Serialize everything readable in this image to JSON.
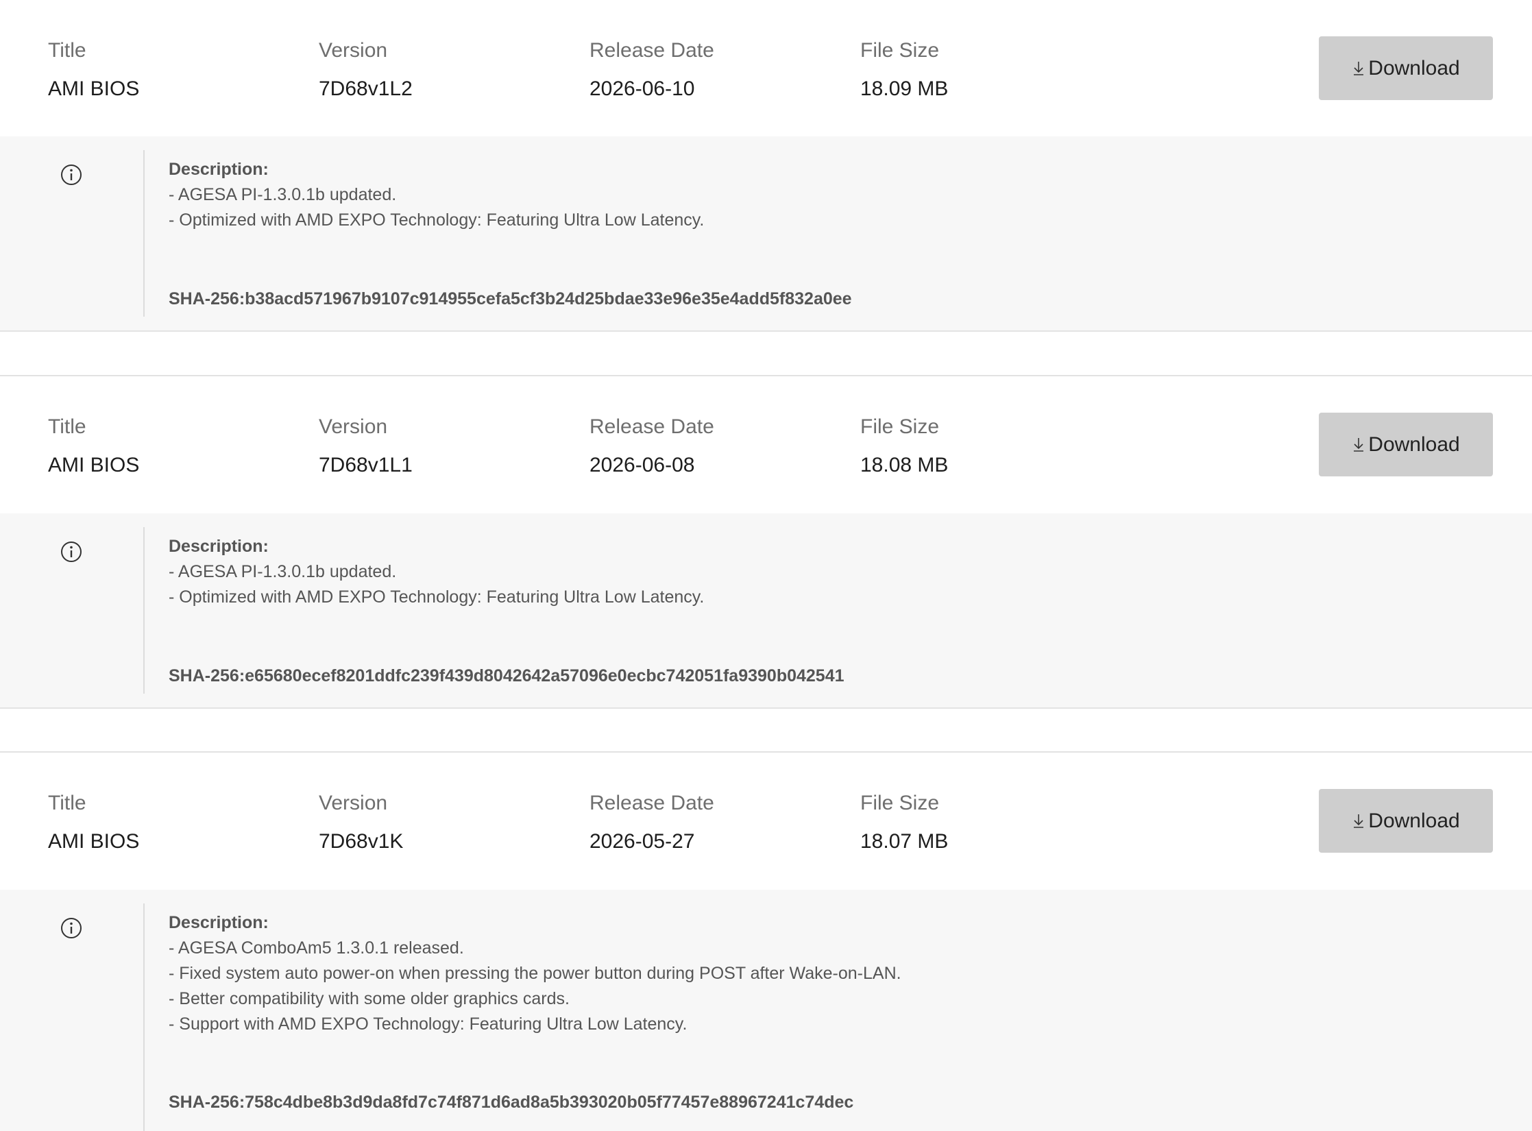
{
  "columns": {
    "title": "Title",
    "version": "Version",
    "release_date": "Release Date",
    "file_size": "File Size"
  },
  "download_label": "Download",
  "description_label": "Description:",
  "icons": {
    "download": "download-arrow-icon",
    "info": "info-circle-icon"
  },
  "items": [
    {
      "title": "AMI BIOS",
      "version": "7D68v1L2",
      "release_date": "2026-06-10",
      "file_size": "18.09 MB",
      "description": [
        "- AGESA PI-1.3.0.1b updated.",
        "- Optimized with AMD EXPO Technology: Featuring Ultra Low Latency."
      ],
      "sha": "SHA-256:b38acd571967b9107c914955cefa5cf3b24d25bdae33e96e35e4add5f832a0ee"
    },
    {
      "title": "AMI BIOS",
      "version": "7D68v1L1",
      "release_date": "2026-06-08",
      "file_size": "18.08 MB",
      "description": [
        "- AGESA PI-1.3.0.1b updated.",
        "- Optimized with AMD EXPO Technology: Featuring Ultra Low Latency."
      ],
      "sha": "SHA-256:e65680ecef8201ddfc239f439d8042642a57096e0ecbc742051fa9390b042541"
    },
    {
      "title": "AMI BIOS",
      "version": "7D68v1K",
      "release_date": "2026-05-27",
      "file_size": "18.07 MB",
      "description": [
        "- AGESA ComboAm5 1.3.0.1 released.",
        "- Fixed system auto power-on when pressing the power button during POST after Wake-on-LAN.",
        "- Better compatibility with some older graphics cards.",
        "- Support with AMD EXPO Technology: Featuring Ultra Low Latency."
      ],
      "sha": "SHA-256:758c4dbe8b3d9da8fd7c74f871d6ad8a5b393020b05f77457e88967241c74dec"
    }
  ]
}
